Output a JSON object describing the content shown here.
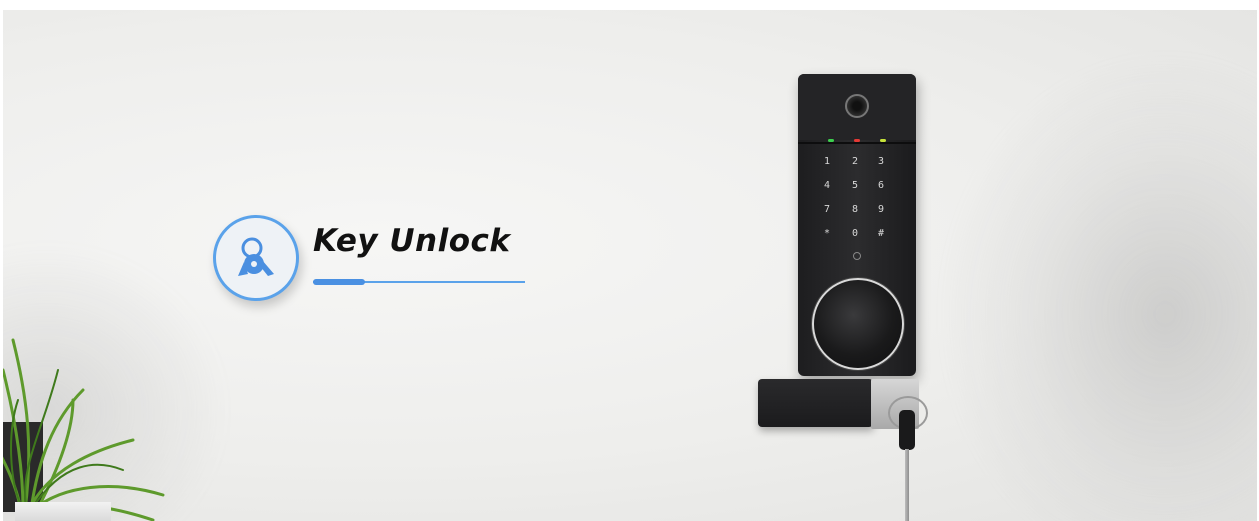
{
  "feature": {
    "title": "Key Unlock",
    "icon": "keys-icon",
    "accent_color": "#4a90e2"
  },
  "lock": {
    "keypad_keys": [
      "1",
      "2",
      "3",
      "4",
      "5",
      "6",
      "7",
      "8",
      "9",
      "*",
      "0",
      "#"
    ],
    "led_colors": [
      "#3ccf4e",
      "#e53935",
      "#c6e23a"
    ]
  }
}
